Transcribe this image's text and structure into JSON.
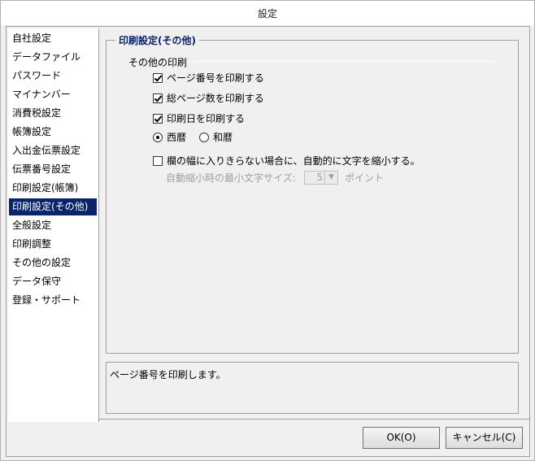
{
  "window": {
    "title": "設定"
  },
  "sidebar": {
    "items": [
      {
        "label": "自社設定"
      },
      {
        "label": "データファイル"
      },
      {
        "label": "パスワード"
      },
      {
        "label": "マイナンバー"
      },
      {
        "label": "消費税設定"
      },
      {
        "label": "帳簿設定"
      },
      {
        "label": "入出金伝票設定"
      },
      {
        "label": "伝票番号設定"
      },
      {
        "label": "印刷設定(帳簿)"
      },
      {
        "label": "印刷設定(その他)",
        "selected": true
      },
      {
        "label": "全般設定"
      },
      {
        "label": "印刷調整"
      },
      {
        "label": "その他の設定"
      },
      {
        "label": "データ保守"
      },
      {
        "label": "登録・サポート"
      }
    ]
  },
  "main": {
    "group_title": "印刷設定(その他)",
    "section_label": "その他の印刷",
    "options": {
      "page_number": {
        "label": "ページ番号を印刷する",
        "checked": true
      },
      "total_pages": {
        "label": "総ページ数を印刷する",
        "checked": true
      },
      "print_date": {
        "label": "印刷日を印刷する",
        "checked": true
      }
    },
    "era": {
      "western": {
        "label": "西暦",
        "selected": true
      },
      "japanese": {
        "label": "和暦",
        "selected": false
      }
    },
    "shrink": {
      "label": "欄の幅に入りきらない場合に、自動的に文字を縮小する。",
      "checked": false,
      "min_size_label": "自動縮小時の最小文字サイズ:",
      "min_size_value": "5",
      "unit_label": "ポイント"
    },
    "description": "ページ番号を印刷します。"
  },
  "buttons": {
    "ok": "OK(O)",
    "cancel": "キャンセル(C)"
  }
}
